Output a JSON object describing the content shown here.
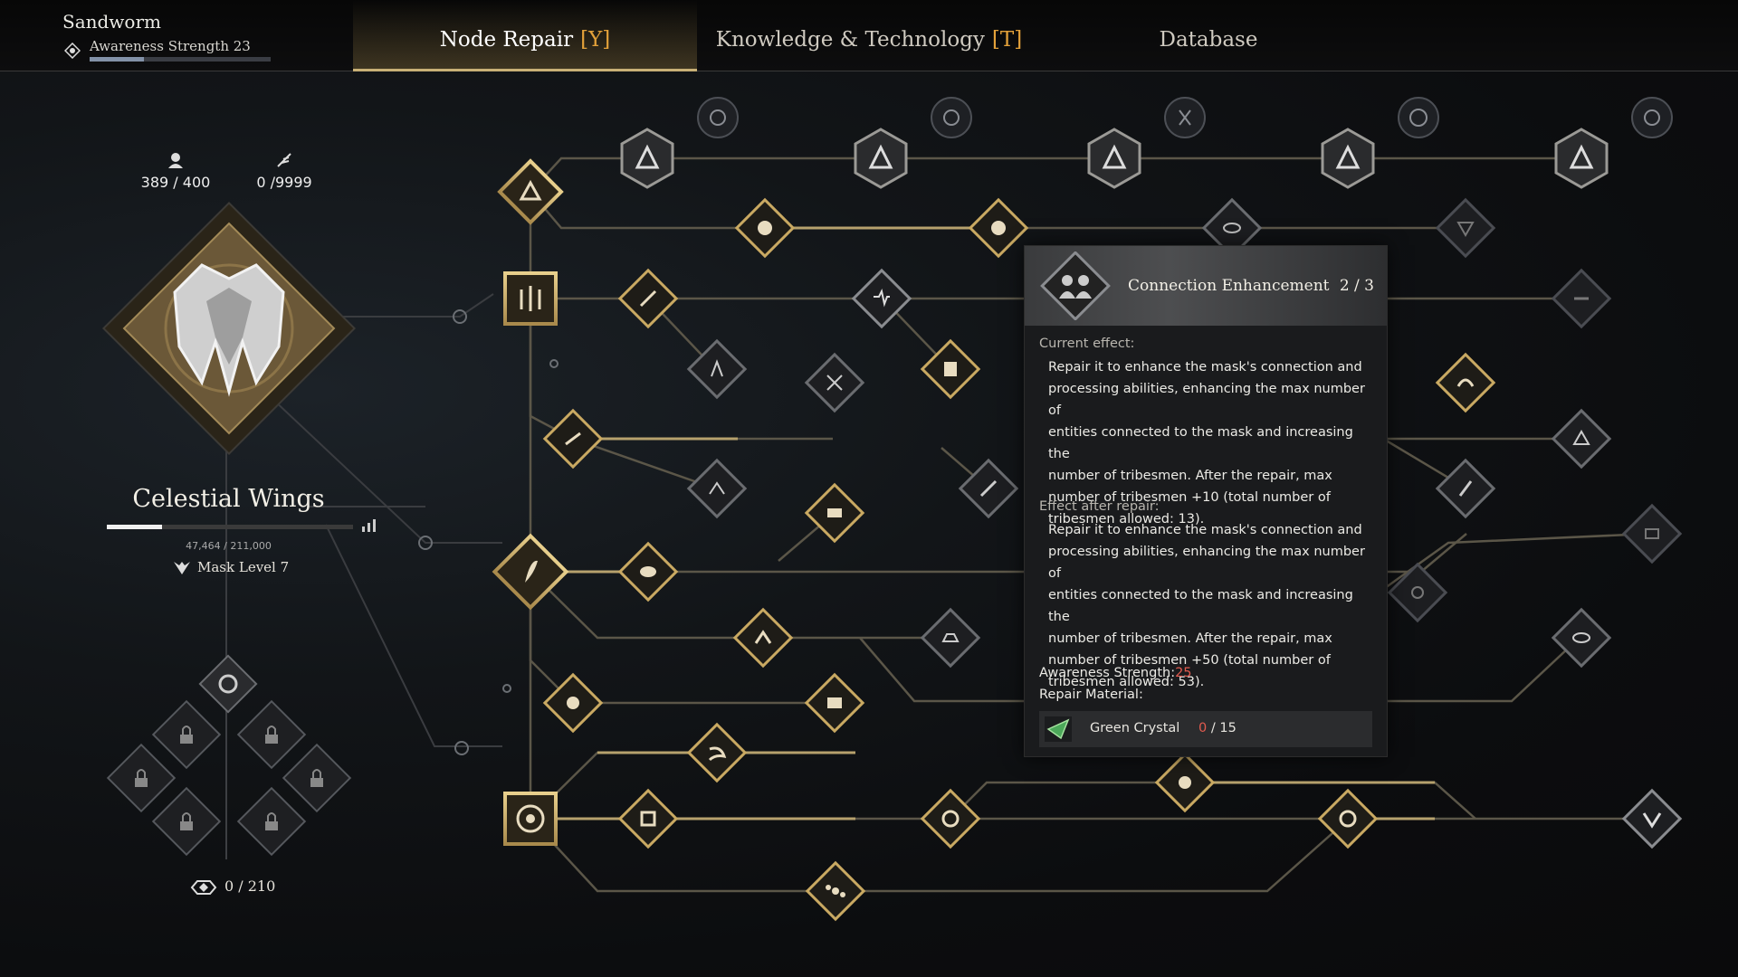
{
  "player": {
    "name": "Sandworm",
    "awareness_label": "Awareness Strength 23",
    "awareness_progress_fraction": 0.3
  },
  "tabs": [
    {
      "label": "Node Repair",
      "key": "[Y]",
      "active": true
    },
    {
      "label": "Knowledge & Technology",
      "key": "[T]",
      "active": false
    },
    {
      "label": "Database",
      "key": "",
      "active": false
    }
  ],
  "resources": {
    "tribesmen": "389 / 400",
    "feathers": "0 /9999"
  },
  "mask": {
    "name": "Celestial Wings",
    "exp_text": "47,464 / 211,000",
    "exp_fraction": 0.225,
    "level": "Mask Level 7",
    "shards": "0 / 210"
  },
  "tooltip": {
    "title": "Connection Enhancement",
    "level": "2 / 3",
    "current_effect_label": "Current effect:",
    "current_effect_lines": [
      "Repair it to enhance the mask's connection and",
      "processing abilities, enhancing the max number of",
      "entities connected to the mask and increasing the",
      "number of tribesmen. After the repair, max",
      "number of tribesmen +10 (total number of",
      "tribesmen allowed: 13)."
    ],
    "after_effect_label": "Effect after repair:",
    "after_effect_lines": [
      "Repair it to enhance the mask's connection and",
      "processing abilities, enhancing the max number of",
      "entities connected to the mask and increasing the",
      "number of tribesmen. After the repair, max",
      "number of tribesmen +50 (total number of",
      "tribesmen allowed: 53)."
    ],
    "awareness_label": "Awareness Strength:",
    "awareness_value": "25",
    "material_label": "Repair Material:",
    "material_name": "Green Crystal",
    "material_have": "0",
    "material_need": " / 15"
  },
  "colors": {
    "gold": "#c9a962",
    "accent_key": "#e3a13a",
    "warning_red": "#e25b4f",
    "locked_node": "#4a4c52"
  },
  "nodes": [
    {
      "id": "core-1",
      "icon": "triangle-icon",
      "state": "active"
    },
    {
      "id": "core-2",
      "icon": "trident-icon",
      "state": "active"
    },
    {
      "id": "core-3",
      "icon": "feather-icon",
      "state": "active"
    },
    {
      "id": "core-4",
      "icon": "compass-icon",
      "state": "active"
    }
  ]
}
